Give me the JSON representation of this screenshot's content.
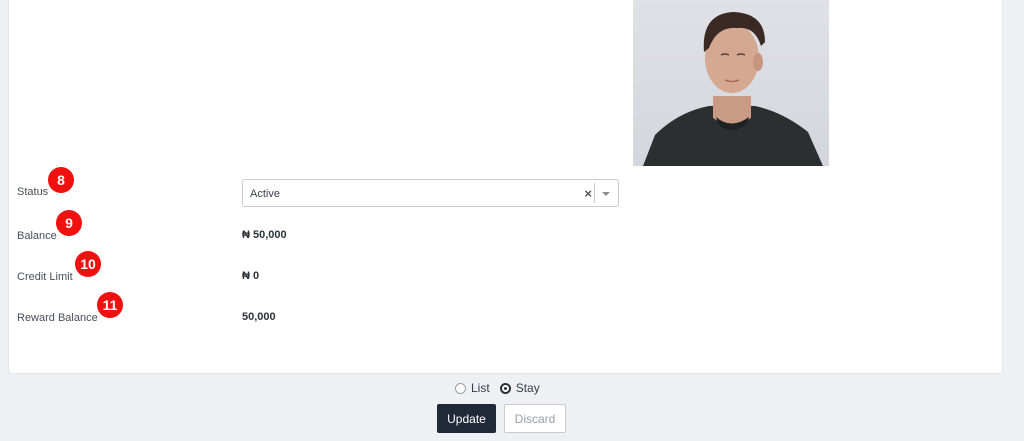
{
  "form": {
    "status": {
      "label": "Status",
      "badge": "8",
      "value": "Active",
      "clear_symbol": "×"
    },
    "balance": {
      "label": "Balance",
      "badge": "9",
      "value": "₦ 50,000"
    },
    "credit_limit": {
      "label": "Credit Limit",
      "badge": "10",
      "value": "₦ 0"
    },
    "reward_balance": {
      "label": "Reward Balance",
      "badge": "11",
      "value": "50,000"
    }
  },
  "after_save": {
    "options": [
      {
        "label": "List",
        "selected": false
      },
      {
        "label": "Stay",
        "selected": true
      }
    ]
  },
  "actions": {
    "update_label": "Update",
    "discard_label": "Discard"
  },
  "colors": {
    "badge": "#f01010",
    "primary_button": "#1f2937"
  }
}
